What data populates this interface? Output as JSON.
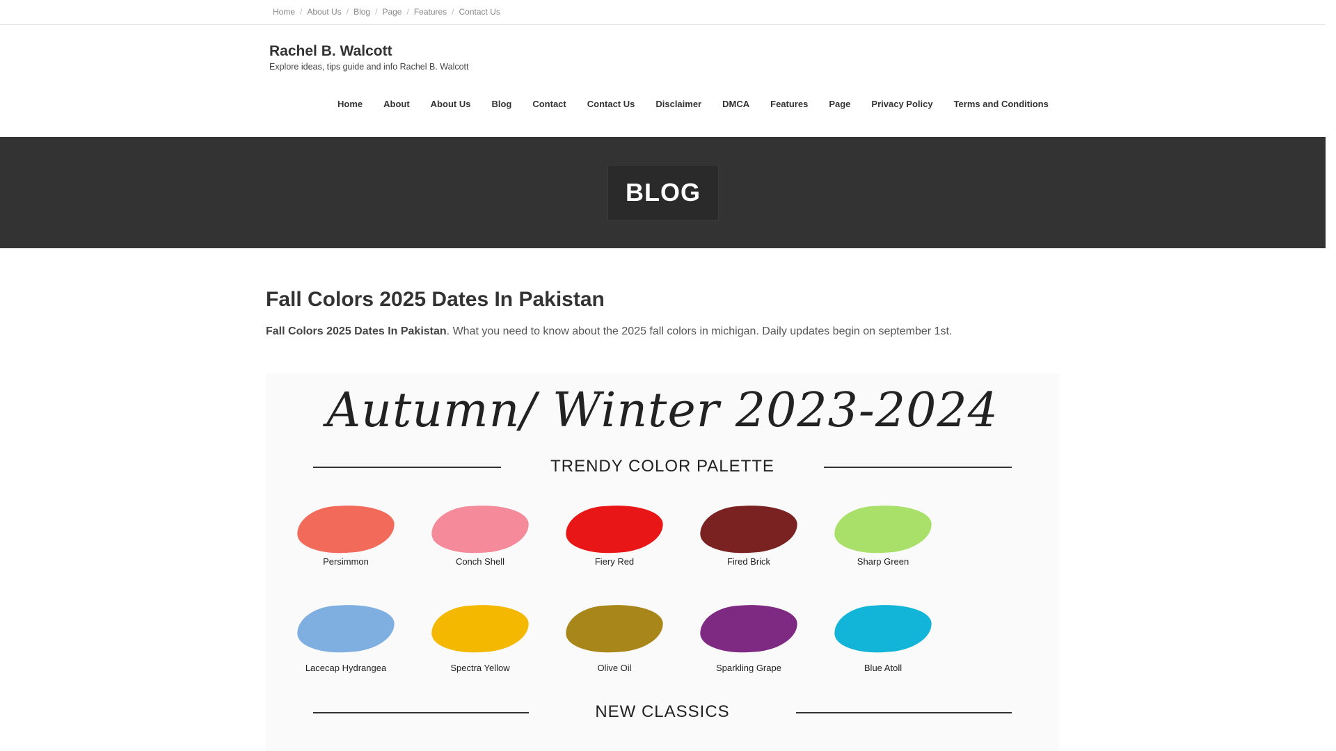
{
  "topbar": {
    "items": [
      "Home",
      "About Us",
      "Blog",
      "Page",
      "Features",
      "Contact Us"
    ],
    "separator": "/"
  },
  "brand": {
    "title": "Rachel B. Walcott",
    "tagline": "Explore ideas, tips guide and info Rachel B. Walcott"
  },
  "mainnav": {
    "items": [
      "Home",
      "About",
      "About Us",
      "Blog",
      "Contact",
      "Contact Us",
      "Disclaimer",
      "DMCA",
      "Features",
      "Page",
      "Privacy Policy",
      "Terms and Conditions"
    ]
  },
  "hero": {
    "label": "BLOG",
    "bg": "#333333"
  },
  "article": {
    "title": "Fall Colors 2025 Dates In Pakistan",
    "lead_bold": "Fall Colors 2025 Dates In Pakistan",
    "lead_rest": ". What you need to know about the 2025 fall colors in michigan. Daily updates begin on september 1st."
  },
  "figure": {
    "title": "Autumn/ Winter 2023-2024",
    "subtitle": "TRENDY COLOR PALETTE",
    "section2": "NEW CLASSICS",
    "swatches": [
      {
        "name": "Persimmon",
        "color": "#f26a5a"
      },
      {
        "name": "Conch Shell",
        "color": "#f48a9a"
      },
      {
        "name": "Fiery Red",
        "color": "#e81616"
      },
      {
        "name": "Fired Brick",
        "color": "#7a2222"
      },
      {
        "name": "Sharp Green",
        "color": "#a8e06a"
      },
      {
        "name": "Lacecap Hydrangea",
        "color": "#7faee0"
      },
      {
        "name": "Spectra Yellow",
        "color": "#f5b800"
      },
      {
        "name": "Olive Oil",
        "color": "#a8861a"
      },
      {
        "name": "Sparkling Grape",
        "color": "#7e2a82"
      },
      {
        "name": "Blue Atoll",
        "color": "#12b4d8"
      }
    ]
  }
}
